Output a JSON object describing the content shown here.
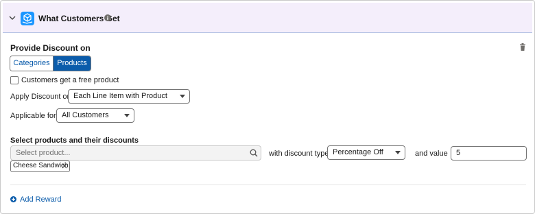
{
  "header": {
    "title": "What Customers Get",
    "icons": {
      "collapse": "chevron-down-icon",
      "app": "gift-box-icon",
      "info": "info-icon"
    }
  },
  "colors": {
    "header_bg": "#f4eefb",
    "accent": "#0b5cab",
    "app_icon": "#1b96ff"
  },
  "discount": {
    "section_title": "Provide Discount on",
    "segments": [
      {
        "label": "Categories",
        "selected": false
      },
      {
        "label": "Products",
        "selected": true
      }
    ],
    "free_product_label": "Customers get a free product",
    "free_product_checked": false,
    "apply_label": "Apply Discount on",
    "apply_value": "Each Line Item with Product",
    "applicable_label": "Applicable for",
    "applicable_value": "All Customers"
  },
  "products": {
    "title": "Select products and their discounts",
    "search_placeholder": "Select product...",
    "discount_type_label": "with discount type",
    "discount_type_value": "Percentage Off",
    "value_label": "and value",
    "value": "5",
    "selected_pill": "Cheese Sandwich"
  },
  "footer": {
    "add_reward_label": "Add Reward"
  }
}
